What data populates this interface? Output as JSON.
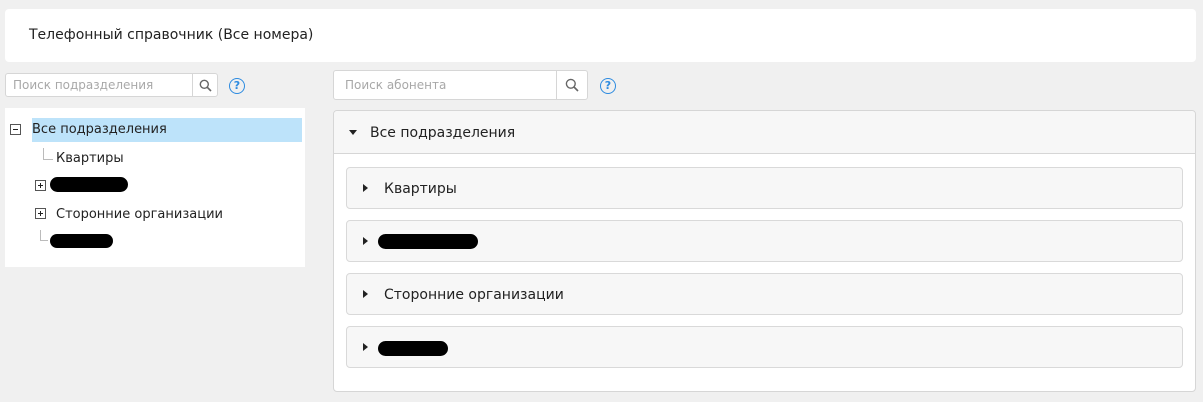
{
  "header": {
    "title": "Телефонный справочник (Все номера)"
  },
  "left_search": {
    "placeholder": "Поиск подразделения",
    "help": "?"
  },
  "right_search": {
    "placeholder": "Поиск абонента",
    "help": "?"
  },
  "tree": {
    "root": "Все подразделения",
    "items": [
      {
        "label": "Квартиры"
      },
      {
        "label": "",
        "redacted": true
      },
      {
        "label": "Сторонние организации"
      },
      {
        "label": "",
        "redacted": true
      }
    ]
  },
  "panel": {
    "title": "Все подразделения",
    "groups": [
      {
        "label": "Квартиры"
      },
      {
        "label": "",
        "redacted": true
      },
      {
        "label": "Сторонние организации"
      },
      {
        "label": "",
        "redacted": true
      }
    ]
  },
  "colors": {
    "selected": "#bde3fa",
    "help": "#2d8be0"
  }
}
